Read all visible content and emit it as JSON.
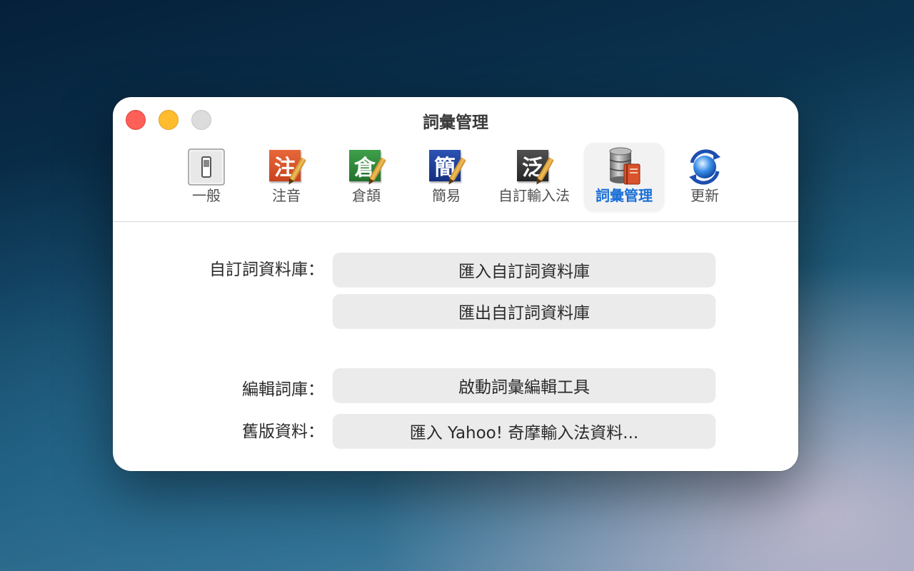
{
  "window": {
    "title": "詞彙管理"
  },
  "toolbar": {
    "items": [
      {
        "label": "一般",
        "icon": "switch-icon"
      },
      {
        "label": "注音",
        "icon": "zhuyin-icon",
        "glyph": "注",
        "color": "#d9532c"
      },
      {
        "label": "倉頡",
        "icon": "cangjie-icon",
        "glyph": "倉",
        "color": "#2f8a3a"
      },
      {
        "label": "簡易",
        "icon": "simplex-icon",
        "glyph": "簡",
        "color": "#1f3f9a"
      },
      {
        "label": "自訂輸入法",
        "icon": "custom-im-icon",
        "glyph": "泛",
        "color": "#3a3a3a"
      },
      {
        "label": "詞彙管理",
        "icon": "database-icon",
        "selected": true
      },
      {
        "label": "更新",
        "icon": "update-globe-icon"
      }
    ]
  },
  "sections": {
    "custom_db_label": "自訂詞資料庫：",
    "import_custom_db": "匯入自訂詞資料庫",
    "export_custom_db": "匯出自訂詞資料庫",
    "edit_db_label": "編輯詞庫：",
    "launch_editor": "啟動詞彙編輯工具",
    "legacy_label": "舊版資料：",
    "import_yahoo": "匯入 Yahoo! 奇摩輸入法資料..."
  },
  "colors": {
    "accent": "#1a6fd6",
    "close": "#fe5f57",
    "minimize": "#febc2e",
    "zoom_disabled": "#dcdcdc"
  }
}
